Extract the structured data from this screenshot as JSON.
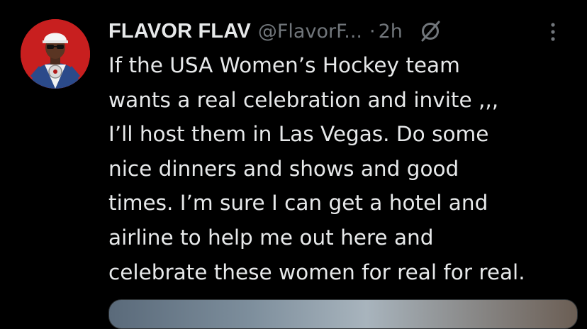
{
  "user": {
    "display_name": "FLAVOR FLAV",
    "handle": "@FlavorF...",
    "separator": "·",
    "time": "2h"
  },
  "icons": {
    "grok": "grok-slash-icon",
    "more": "more-vertical-icon",
    "avatar": "profile-photo"
  },
  "tweet": {
    "lines": [
      "If the USA Women’s Hockey team",
      "wants a real celebration and invite ,,,",
      "I’ll host them in Las Vegas. Do some",
      "nice dinners and shows and good",
      "times. I’m sure I can get a hotel and",
      "airline to help me out here and",
      "celebrate these women for real for real."
    ]
  },
  "colors": {
    "background": "#000000",
    "primary_text": "#e7e9ea",
    "secondary_text": "#71767b",
    "avatar_bg": "#c81f1f"
  }
}
